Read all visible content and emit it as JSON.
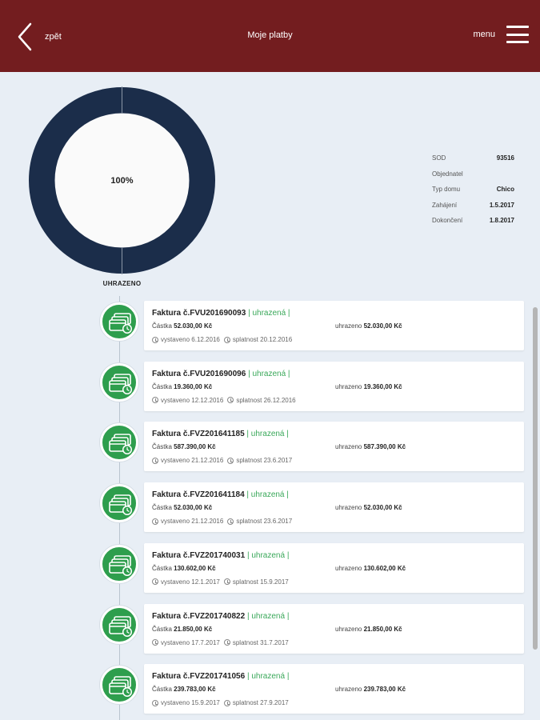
{
  "header": {
    "back_label": "zpět",
    "title": "Moje platby",
    "menu_label": "menu"
  },
  "colors": {
    "header_bg": "#731d1f",
    "donut_ring": "#1b2d4a",
    "status_green": "#3aa85a",
    "badge_green": "#2e9e4d"
  },
  "donut": {
    "center_text": "100%",
    "label": "UHRAZENO",
    "fraction_paid": 1.0
  },
  "info": [
    {
      "key": "SOD",
      "value": "93516"
    },
    {
      "key": "Objednatel",
      "value": ""
    },
    {
      "key": "Typ domu",
      "value": "Chico"
    },
    {
      "key": "Zahájení",
      "value": "1.5.2017"
    },
    {
      "key": "Dokončení",
      "value": "1.8.2017"
    }
  ],
  "invoices": [
    {
      "number": "Faktura č.FVU201690093",
      "status": "| uhrazená |",
      "amount_label": "Částka",
      "amount": "52.030,00 Kč",
      "paid_label": "uhrazeno",
      "paid": "52.030,00 Kč",
      "issued_label": "vystaveno",
      "issued": "6.12.2016",
      "due_label": "splatnost",
      "due": "20.12.2016"
    },
    {
      "number": "Faktura č.FVU201690096",
      "status": "| uhrazená |",
      "amount_label": "Částka",
      "amount": "19.360,00 Kč",
      "paid_label": "uhrazeno",
      "paid": "19.360,00 Kč",
      "issued_label": "vystaveno",
      "issued": "12.12.2016",
      "due_label": "splatnost",
      "due": "26.12.2016"
    },
    {
      "number": "Faktura č.FVZ201641185",
      "status": "| uhrazená |",
      "amount_label": "Částka",
      "amount": "587.390,00 Kč",
      "paid_label": "uhrazeno",
      "paid": "587.390,00 Kč",
      "issued_label": "vystaveno",
      "issued": "21.12.2016",
      "due_label": "splatnost",
      "due": "23.6.2017"
    },
    {
      "number": "Faktura č.FVZ201641184",
      "status": "| uhrazená |",
      "amount_label": "Částka",
      "amount": "52.030,00 Kč",
      "paid_label": "uhrazeno",
      "paid": "52.030,00 Kč",
      "issued_label": "vystaveno",
      "issued": "21.12.2016",
      "due_label": "splatnost",
      "due": "23.6.2017"
    },
    {
      "number": "Faktura č.FVZ201740031",
      "status": "| uhrazená |",
      "amount_label": "Částka",
      "amount": "130.602,00 Kč",
      "paid_label": "uhrazeno",
      "paid": "130.602,00 Kč",
      "issued_label": "vystaveno",
      "issued": "12.1.2017",
      "due_label": "splatnost",
      "due": "15.9.2017"
    },
    {
      "number": "Faktura č.FVZ201740822",
      "status": "| uhrazená |",
      "amount_label": "Částka",
      "amount": "21.850,00 Kč",
      "paid_label": "uhrazeno",
      "paid": "21.850,00 Kč",
      "issued_label": "vystaveno",
      "issued": "17.7.2017",
      "due_label": "splatnost",
      "due": "31.7.2017"
    },
    {
      "number": "Faktura č.FVZ201741056",
      "status": "| uhrazená |",
      "amount_label": "Částka",
      "amount": "239.783,00 Kč",
      "paid_label": "uhrazeno",
      "paid": "239.783,00 Kč",
      "issued_label": "vystaveno",
      "issued": "15.9.2017",
      "due_label": "splatnost",
      "due": "27.9.2017"
    }
  ]
}
